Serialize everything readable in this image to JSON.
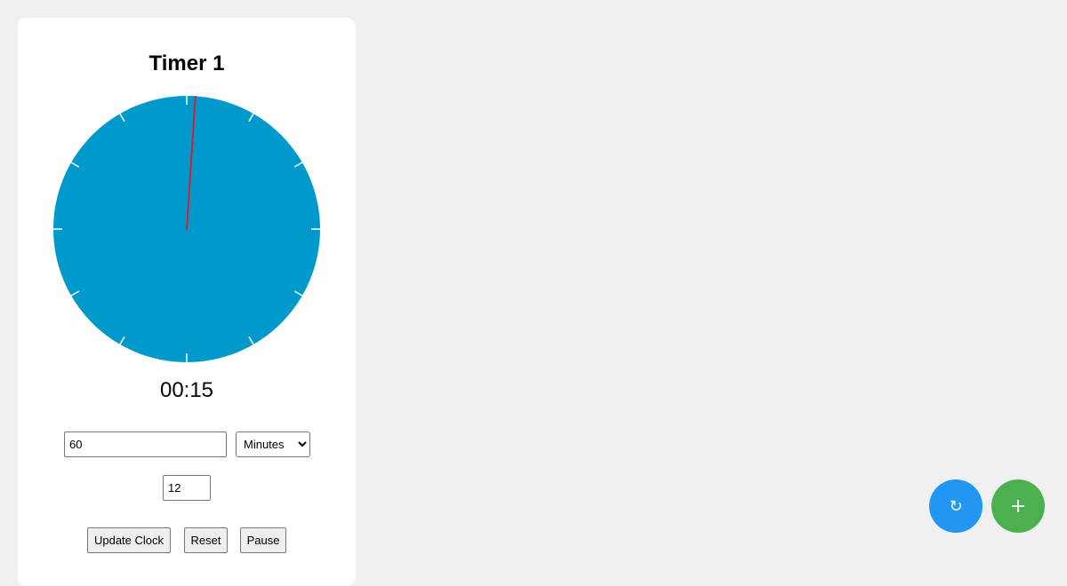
{
  "timer": {
    "title": "Timer 1",
    "time_display": "00:15",
    "duration_value": "60",
    "unit_selected": "Minutes",
    "unit_options": [
      "Minutes"
    ],
    "ticks_value": "12",
    "elapsed_fraction": 0.0104
  },
  "buttons": {
    "update_label": "Update Clock",
    "reset_label": "Reset",
    "pause_label": "Pause"
  },
  "fabs": {
    "refresh_glyph": "↻",
    "add_glyph": "+"
  },
  "icons": {
    "refresh": "refresh-icon",
    "add": "plus-icon"
  },
  "colors": {
    "clock_face": "#0099cc",
    "hand": "#cc2233",
    "tick": "#ffffff",
    "fab_refresh": "#2196f3",
    "fab_add": "#4caf50"
  }
}
